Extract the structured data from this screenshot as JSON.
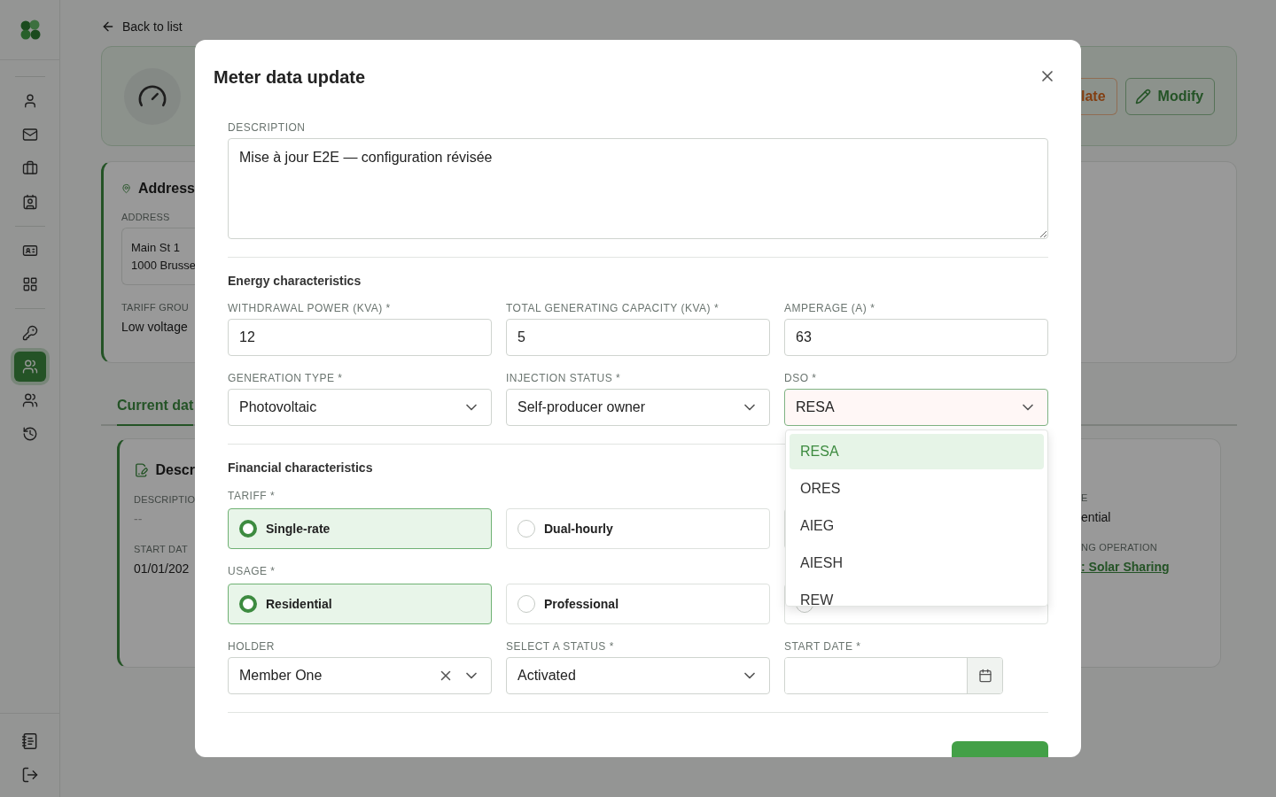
{
  "sidebar": {
    "items": [
      {
        "kind": "user",
        "selected": false
      },
      {
        "kind": "mail",
        "selected": false
      },
      {
        "kind": "briefcase",
        "selected": false
      },
      {
        "kind": "contacts",
        "selected": false
      },
      {
        "kind": "id-card",
        "selected": false
      },
      {
        "kind": "grid",
        "selected": false
      },
      {
        "kind": "key",
        "selected": false
      },
      {
        "kind": "users",
        "selected": true
      },
      {
        "kind": "users",
        "selected": false
      },
      {
        "kind": "history",
        "selected": false
      }
    ],
    "footer": [
      {
        "kind": "notebook"
      },
      {
        "kind": "logout"
      }
    ]
  },
  "page": {
    "back_link": "Back to list",
    "header_actions": [
      {
        "kind": "warning",
        "label": "late"
      },
      {
        "kind": "primary",
        "label": "Modify"
      }
    ],
    "address_card": {
      "title": "Address",
      "address_label": "ADDRESS",
      "address_lines": [
        "Main St 1",
        "1000 Brusse"
      ],
      "tariff_label": "TARIFF GROU",
      "tariff_value": "Low voltage"
    },
    "tabs": [
      {
        "label": "Current dat",
        "selected": true
      }
    ],
    "description_card": {
      "title": "Descr",
      "left_fields": [
        {
          "label": "DESCRIPTIO",
          "value": "--",
          "kind": "muted"
        },
        {
          "label": "START DAT",
          "value": "01/01/202",
          "kind": "text"
        }
      ],
      "right_fields": [
        {
          "label": "E",
          "value": "ential",
          "kind": "text"
        },
        {
          "label": "NG OPERATION",
          "value": ": Solar Sharing",
          "kind": "link"
        }
      ]
    }
  },
  "dialog": {
    "title": "Meter data update",
    "description": {
      "label": "DESCRIPTION",
      "value": "Mise à jour E2E — configuration révisée"
    },
    "energy": {
      "heading": "Energy characteristics",
      "fields": [
        {
          "kind": "input",
          "label": "WITHDRAWAL POWER (KVA) *",
          "value": "12"
        },
        {
          "kind": "input",
          "label": "TOTAL GENERATING CAPACITY (KVA) *",
          "value": "5"
        },
        {
          "kind": "input",
          "label": "AMPERAGE (A) *",
          "value": "63"
        },
        {
          "kind": "select",
          "label": "GENERATION TYPE *",
          "value": "Photovoltaic",
          "expanded": false
        },
        {
          "kind": "select",
          "label": "INJECTION STATUS *",
          "value": "Self-producer owner",
          "expanded": false
        },
        {
          "kind": "select",
          "label": "DSO *",
          "value": "RESA",
          "expanded": true,
          "options": [
            {
              "label": "RESA",
              "selected": true
            },
            {
              "label": "ORES",
              "selected": false
            },
            {
              "label": "AIEG",
              "selected": false
            },
            {
              "label": "AIESH",
              "selected": false
            },
            {
              "label": "REW",
              "selected": false
            }
          ]
        }
      ]
    },
    "financial": {
      "heading": "Financial characteristics",
      "groups": [
        {
          "label": "TARIFF *",
          "options": [
            {
              "label": "Single-rate",
              "selected": true
            },
            {
              "label": "Dual-hourly",
              "selected": false
            },
            {
              "selected": false
            }
          ]
        },
        {
          "label": "USAGE *",
          "options": [
            {
              "label": "Residential",
              "selected": true
            },
            {
              "label": "Professional",
              "selected": false
            },
            {
              "selected": false
            }
          ]
        }
      ]
    },
    "bottom_fields": [
      {
        "kind": "combo",
        "label": "HOLDER",
        "value": "Member One",
        "clearable": true
      },
      {
        "kind": "select",
        "label": "SELECT A STATUS *",
        "value": "Activated",
        "expanded": false
      },
      {
        "kind": "date",
        "label": "START DATE *"
      }
    ]
  }
}
